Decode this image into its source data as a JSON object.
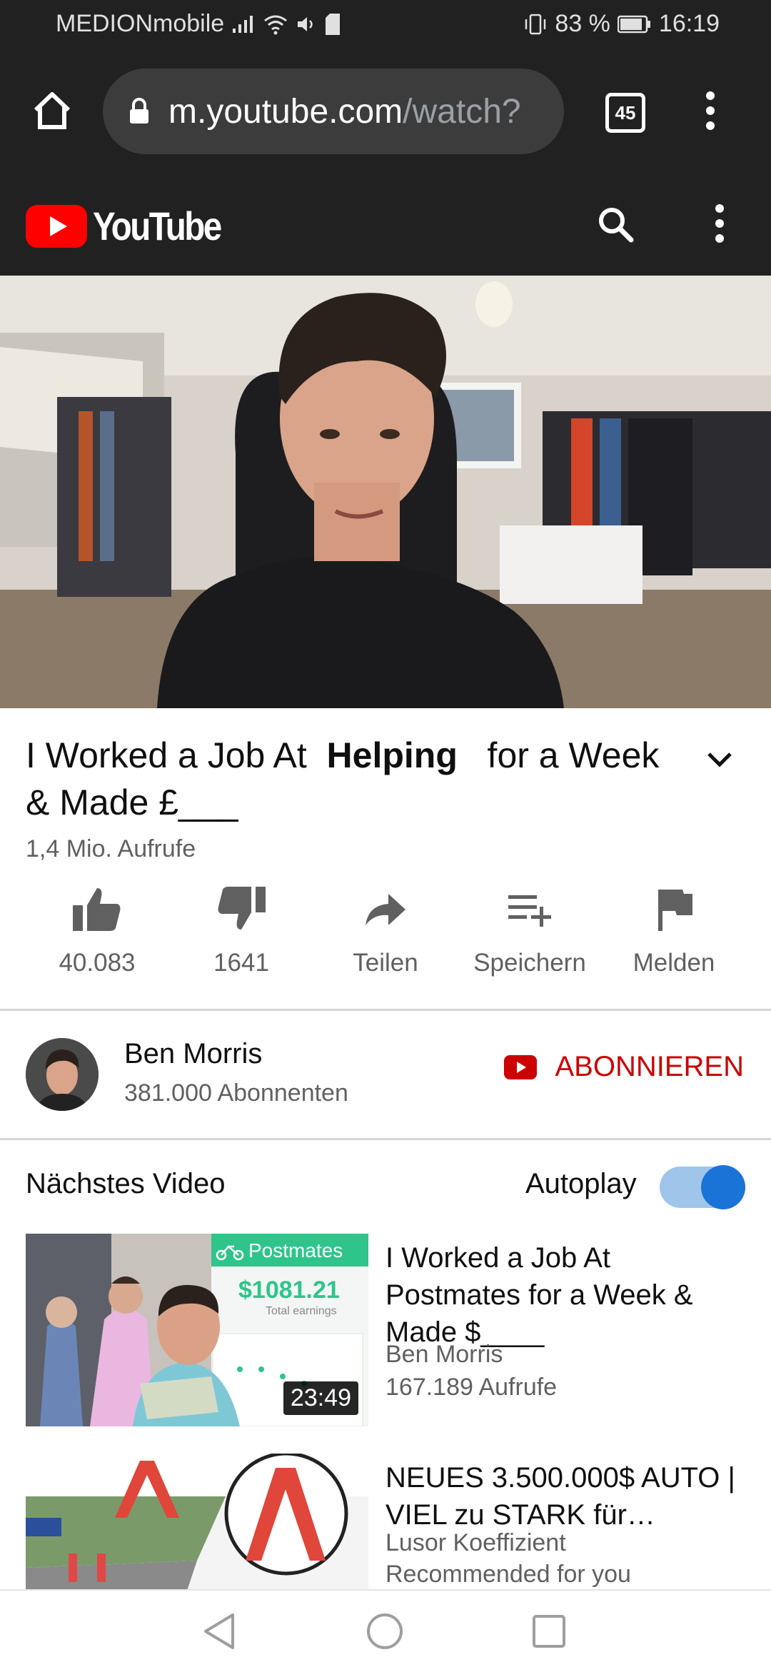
{
  "status_bar": {
    "carrier": "MEDIONmobile",
    "battery": "83 %",
    "time": "16:19"
  },
  "browser": {
    "url_main": "m.youtube.com",
    "url_rest": "/watch?",
    "tab_count": "45"
  },
  "header": {
    "logo_text": "YouTube"
  },
  "video": {
    "title_part1": "I Worked a Job At",
    "title_bold": "Helping",
    "title_part2": "for a Week",
    "title_line2": "& Made £___",
    "views": "1,4 Mio. Aufrufe"
  },
  "actions": {
    "like_count": "40.083",
    "dislike_count": "1641",
    "share_label": "Teilen",
    "save_label": "Speichern",
    "report_label": "Melden"
  },
  "channel": {
    "name": "Ben Morris",
    "subscribers": "381.000 Abonnenten",
    "subscribe_label": "ABONNIEREN"
  },
  "up_next": {
    "label": "Nächstes Video",
    "autoplay_label": "Autoplay",
    "autoplay_on": true
  },
  "recommendations": [
    {
      "title": "I Worked a Job At Postmates for a Week & Made $____",
      "channel": "Ben Morris",
      "views": "167.189 Aufrufe",
      "duration": "23:49",
      "thumb_brand": "Postmates",
      "thumb_amount": "$1081.21",
      "thumb_sub": "Total earnings"
    },
    {
      "title": "NEUES 3.500.000$ AUTO | VIEL zu STARK für…",
      "channel": "Lusor Koeffizient",
      "views": "Recommended for you"
    }
  ],
  "colors": {
    "accent_red": "#cc0000",
    "toggle_blue": "#1a73d6",
    "dark_bar": "#212121"
  }
}
